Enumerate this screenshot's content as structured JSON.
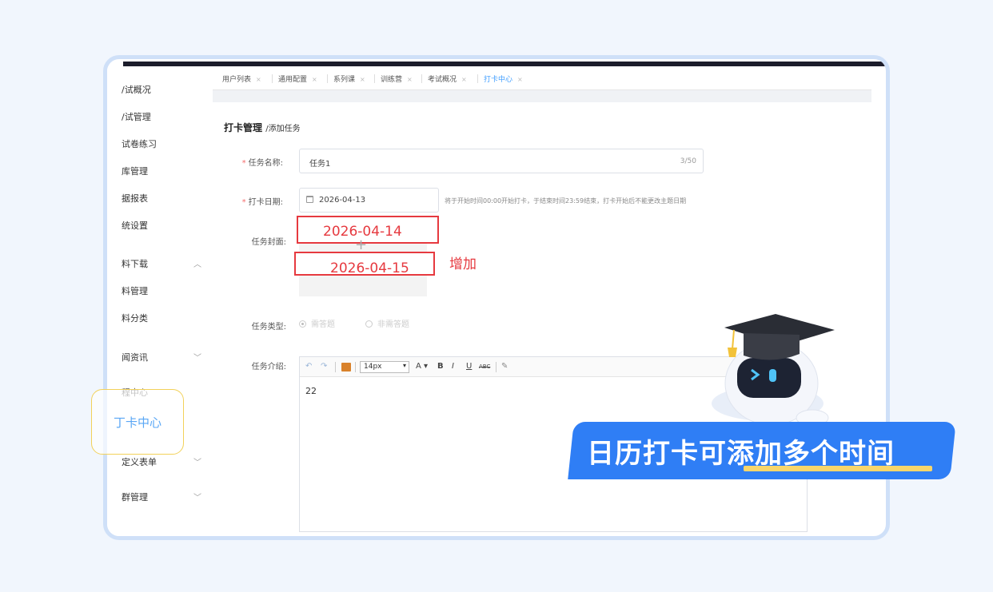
{
  "sidebar": {
    "items": [
      {
        "label": "月试概况",
        "display": "/试概况"
      },
      {
        "label": "考试管理",
        "display": "/试管理"
      },
      {
        "label": "试卷练习",
        "display": "试卷练习"
      },
      {
        "label": "题库管理",
        "display": "题库管理"
      },
      {
        "label": "数据报表",
        "display": "数据报表"
      },
      {
        "label": "系统设置",
        "display": "系统设置"
      },
      {
        "label": "资料下载",
        "display": "资料下载"
      },
      {
        "label": "资料管理",
        "display": "资料管理"
      },
      {
        "label": "资料分类",
        "display": "资料分类"
      },
      {
        "label": "新闻资讯",
        "display": "新闻资讯"
      },
      {
        "label": "课程中心",
        "display": "课程中心"
      },
      {
        "label": "自定义表单",
        "display": "定义表单"
      },
      {
        "label": "社群管理",
        "display": "社群管理"
      }
    ],
    "shown": [
      "/试概况",
      "/试管理",
      "试卷练习",
      "库管理",
      "据报表",
      "统设置",
      "料下载",
      "料管理",
      "料分类",
      "闻资讯",
      "程中心",
      "定义表单",
      "群管理"
    ],
    "highlight": "打卡中心",
    "highlight_shown": "丁卡中心"
  },
  "tabs": [
    {
      "label": "用户列表"
    },
    {
      "label": "通用配置"
    },
    {
      "label": "系列课"
    },
    {
      "label": "训练营"
    },
    {
      "label": "考试概况"
    },
    {
      "label": "打卡中心",
      "active": true
    }
  ],
  "tab_close": "×",
  "page": {
    "title": "打卡管理",
    "subtitle": "/添加任务"
  },
  "form": {
    "task_name_label": "任务名称:",
    "task_name_value": "任务1",
    "task_name_count": "3/50",
    "date_label": "打卡日期:",
    "date_value": "2026-04-13",
    "date_hint": "将于开始时间00:00开始打卡，于结束时间23:59结束，打卡开始后不能更改主题日期",
    "cover_label": "任务封面:",
    "type_label": "任务类型:",
    "type_options": [
      "需答题",
      "非需答题"
    ],
    "intro_label": "任务介绍:",
    "intro_body": "22",
    "required_mark": "*"
  },
  "annotations": {
    "date1": "2026-04-14",
    "date2": "2026-04-15",
    "add_note": "增加"
  },
  "editor_toolbar": {
    "font_size": "14px",
    "bold": "B",
    "italic": "I",
    "underline": "U",
    "strike": "ABC",
    "font_color": "A"
  },
  "banner": {
    "text_part1": "日历打卡可",
    "text_part2": "添加多个时间"
  },
  "colors": {
    "accent": "#409eff",
    "annotation_red": "#e6393f",
    "banner_blue": "#2f7ef5",
    "underline_yellow": "#f8d66b"
  }
}
